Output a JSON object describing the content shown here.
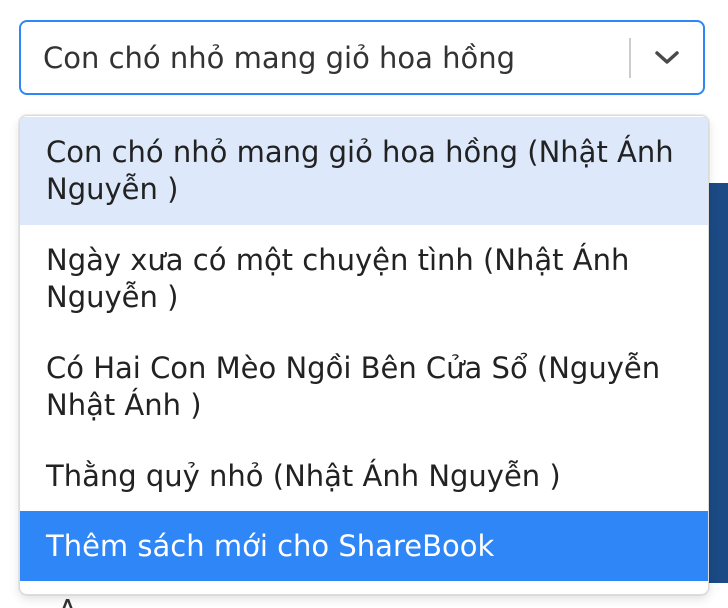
{
  "select": {
    "value": "Con chó nhỏ mang giỏ hoa hồng",
    "indicator_icon": "chevron-down-icon"
  },
  "menu": {
    "options": [
      {
        "label": "Con chó nhỏ mang giỏ hoa hồng (Nhật Ánh Nguyễn )",
        "state": "focused"
      },
      {
        "label": "Ngày xưa có một chuyện tình (Nhật Ánh Nguyễn )",
        "state": "normal"
      },
      {
        "label": "Có Hai Con Mèo Ngồi Bên Cửa Sổ (Nguyễn Nhật Ánh )",
        "state": "normal"
      },
      {
        "label": "Thằng quỷ nhỏ (Nhật Ánh Nguyễn )",
        "state": "normal"
      },
      {
        "label": "Thêm sách mới cho ShareBook",
        "state": "highlighted"
      }
    ]
  },
  "colors": {
    "accent": "#2f86f6",
    "focused_bg": "#dde9fb",
    "background_panel": "#1b4a84"
  }
}
